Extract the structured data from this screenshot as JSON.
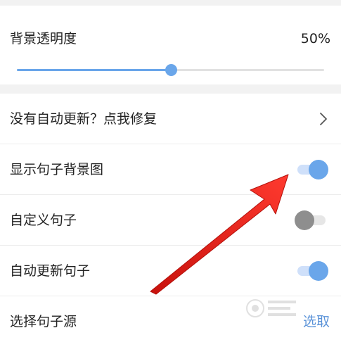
{
  "transparency": {
    "label": "背景透明度",
    "value_text": "50%",
    "slider_fraction": 0.5
  },
  "settings": [
    {
      "label": "没有自动更新？点我修复",
      "control": "chevron"
    },
    {
      "label": "显示句子背景图",
      "control": "toggle",
      "on": true
    },
    {
      "label": "自定义句子",
      "control": "toggle",
      "on": false
    },
    {
      "label": "自动更新句子",
      "control": "toggle",
      "on": true
    },
    {
      "label": "选择句子源",
      "control": "link",
      "action": "选取"
    }
  ],
  "colors": {
    "accent": "#6aa6ea",
    "arrow": "#e0231d"
  },
  "icons": {
    "chevron": "chevron-right-icon",
    "arrow": "red-arrow-annotation",
    "watermark": "watermark-logo"
  }
}
